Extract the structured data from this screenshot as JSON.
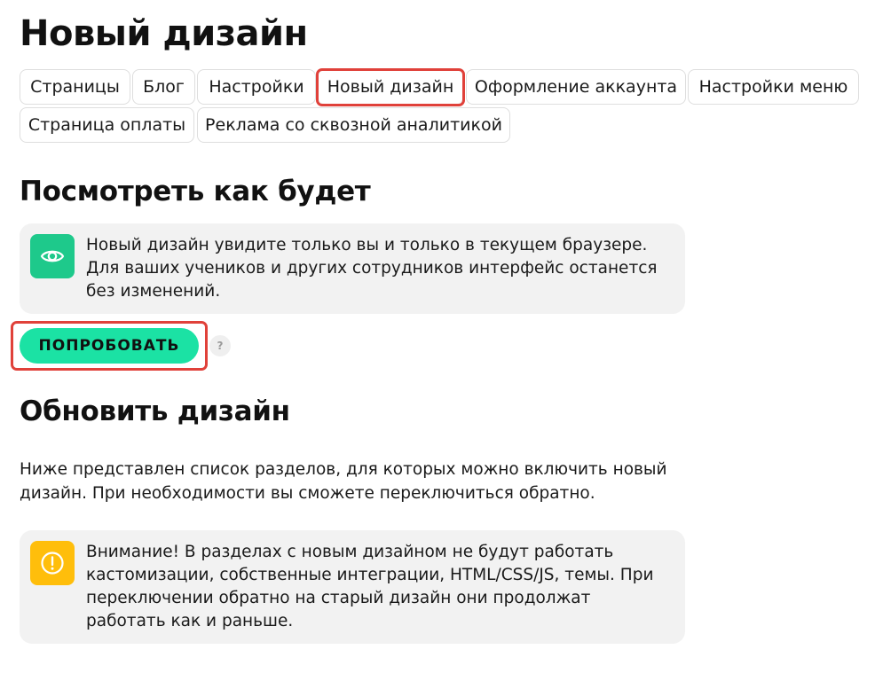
{
  "page": {
    "title": "Новый дизайн"
  },
  "tabs": [
    {
      "label": "Страницы"
    },
    {
      "label": "Блог"
    },
    {
      "label": "Настройки"
    },
    {
      "label": "Новый дизайн",
      "active": true
    },
    {
      "label": "Оформление аккаунта"
    },
    {
      "label": "Настройки меню"
    },
    {
      "label": "Страница оплаты"
    },
    {
      "label": "Реклама со сквозной аналитикой"
    }
  ],
  "preview": {
    "title": "Посмотреть как будет",
    "info_text": "Новый дизайн увидите только вы и только в текущем браузере. Для ваших учеников и других сотрудников интерфейс останется без изменений.",
    "icon": "eye-icon",
    "try_button_label": "ПОПРОБОВАТЬ",
    "help_label": "?"
  },
  "update": {
    "title": "Обновить дизайн",
    "description": "Ниже представлен список разделов, для которых можно включить новый дизайн. При необходимости вы сможете переключиться обратно.",
    "warning_text": "Внимание! В разделах с новым дизайном не будут работать кастомизации, собственные интеграции, HTML/CSS/JS, темы. При переключении обратно на старый дизайн они продолжат работать как и раньше.",
    "warning_icon": "warning-icon"
  },
  "colors": {
    "accent_green": "#1be2a4",
    "eye_icon_bg": "#1ec98b",
    "warning_icon_bg": "#ffbe0b",
    "highlight_red": "#e0413a",
    "box_bg": "#f2f2f2"
  }
}
